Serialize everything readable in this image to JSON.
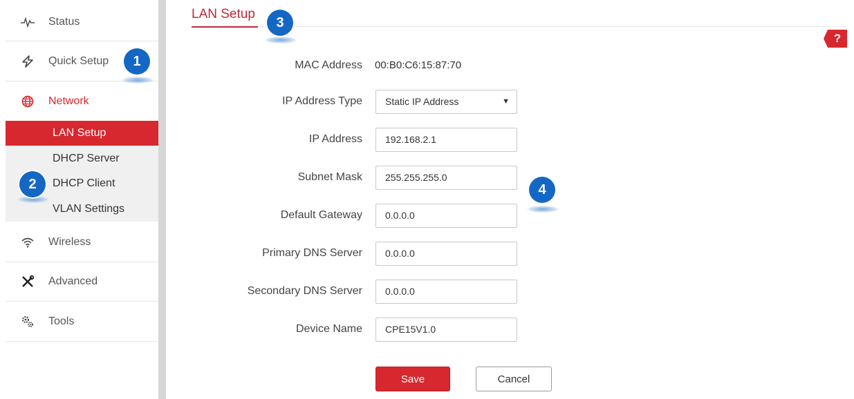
{
  "sidebar": {
    "items": [
      {
        "label": "Status",
        "icon": "pulse-icon"
      },
      {
        "label": "Quick Setup",
        "icon": "flash-icon"
      },
      {
        "label": "Network",
        "icon": "globe-icon"
      },
      {
        "label": "Wireless",
        "icon": "wifi-icon"
      },
      {
        "label": "Advanced",
        "icon": "tools-cross-icon"
      },
      {
        "label": "Tools",
        "icon": "gears-icon"
      }
    ],
    "submenu": [
      {
        "label": "LAN Setup"
      },
      {
        "label": "DHCP Server"
      },
      {
        "label": "DHCP Client"
      },
      {
        "label": "VLAN Settings"
      }
    ]
  },
  "page": {
    "title": "LAN Setup",
    "help": "?"
  },
  "form": {
    "mac_label": "MAC Address",
    "mac_value": "00:B0:C6:15:87:70",
    "ip_type_label": "IP Address Type",
    "ip_type_value": "Static IP Address",
    "ip_label": "IP Address",
    "ip_value": "192.168.2.1",
    "mask_label": "Subnet Mask",
    "mask_value": "255.255.255.0",
    "gateway_label": "Default Gateway",
    "gateway_value": "0.0.0.0",
    "dns1_label": "Primary DNS Server",
    "dns1_value": "0.0.0.0",
    "dns2_label": "Secondary DNS Server",
    "dns2_value": "0.0.0.0",
    "device_label": "Device Name",
    "device_value": "CPE15V1.0"
  },
  "buttons": {
    "save": "Save",
    "cancel": "Cancel"
  },
  "callouts": [
    "1",
    "2",
    "3",
    "4"
  ],
  "colors": {
    "accent": "#d7282f",
    "callout": "#1467c4"
  }
}
